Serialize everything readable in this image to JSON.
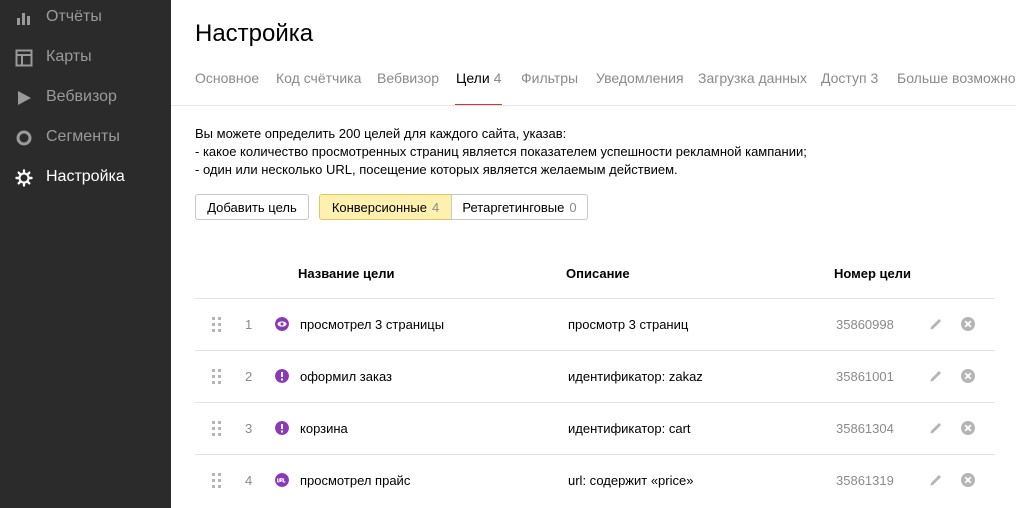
{
  "sidebar": {
    "items": [
      {
        "label": "Отчёты",
        "icon": "bar-chart-icon"
      },
      {
        "label": "Карты",
        "icon": "map-grid-icon"
      },
      {
        "label": "Вебвизор",
        "icon": "play-icon"
      },
      {
        "label": "Сегменты",
        "icon": "segment-ring-icon"
      },
      {
        "label": "Настройка",
        "icon": "gear-icon",
        "active": true
      }
    ]
  },
  "page": {
    "title": "Настройка"
  },
  "tabs": [
    {
      "label": "Основное"
    },
    {
      "label": "Код счётчика"
    },
    {
      "label": "Вебвизор"
    },
    {
      "label": "Цели",
      "count": "4",
      "active": true
    },
    {
      "label": "Фильтры"
    },
    {
      "label": "Уведомления"
    },
    {
      "label": "Загрузка данных"
    },
    {
      "label": "Доступ",
      "count": "3"
    },
    {
      "label": "Больше возможностей"
    }
  ],
  "description": {
    "line1": "Вы можете определить 200 целей для каждого сайта, указав:",
    "line2": "-  какое количество просмотренных страниц является показателем успешности рекламной кампании;",
    "line3": "-  один или несколько URL, посещение которых является желаемым действием."
  },
  "buttons": {
    "add_goal": "Добавить цель",
    "conversion_label": "Конверсионные",
    "conversion_count": "4",
    "retargeting_label": "Ретаргетинговые",
    "retargeting_count": "0"
  },
  "table": {
    "headers": {
      "name": "Название цели",
      "description": "Описание",
      "id": "Номер цели"
    },
    "rows": [
      {
        "num": "1",
        "icon": "eye-icon",
        "name": "просмотрел 3 страницы",
        "description": "просмотр 3 страниц",
        "id": "35860998"
      },
      {
        "num": "2",
        "icon": "exclamation-icon",
        "name": "оформил заказ",
        "description": "идентификатор: zakaz",
        "id": "35861001"
      },
      {
        "num": "3",
        "icon": "exclamation-icon",
        "name": "корзина",
        "description": "идентификатор: cart",
        "id": "35861304"
      },
      {
        "num": "4",
        "icon": "url-icon",
        "name": "просмотрел прайс",
        "description": "url: содержит «price»",
        "id": "35861319"
      }
    ]
  },
  "colors": {
    "sidebar_bg": "#2b2b2b",
    "accent_red": "#e0302e",
    "active_segment": "#fff0b0",
    "goal_icon": "#8a3ab9"
  }
}
